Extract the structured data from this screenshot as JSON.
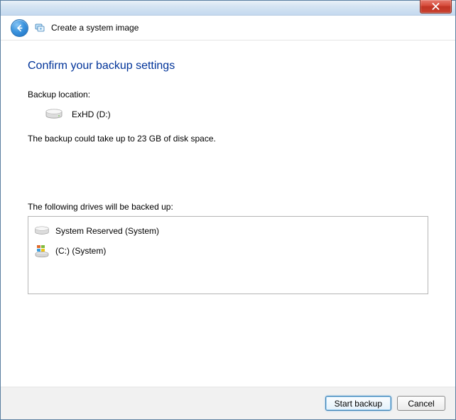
{
  "header": {
    "title": "Create a system image"
  },
  "main": {
    "heading": "Confirm your backup settings",
    "backup_location_label": "Backup location:",
    "backup_location_value": "ExHD (D:)",
    "space_estimate": "The backup could take up to 23 GB of disk space.",
    "drives_label": "The following drives will be backed up:",
    "drives": [
      {
        "name": "System Reserved (System)"
      },
      {
        "name": "(C:) (System)"
      }
    ]
  },
  "footer": {
    "start_label": "Start backup",
    "cancel_label": "Cancel"
  }
}
